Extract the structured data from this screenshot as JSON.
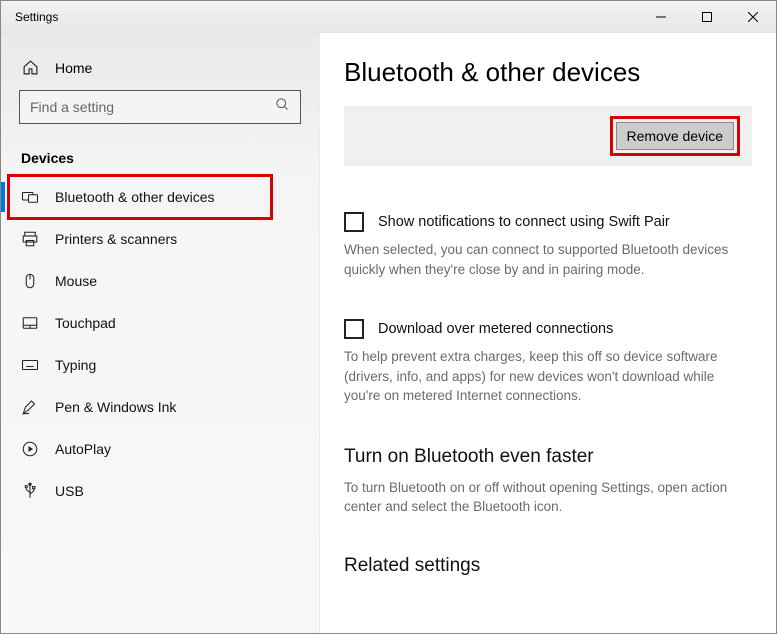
{
  "window_title": "Settings",
  "sidebar": {
    "home_label": "Home",
    "search_placeholder": "Find a setting",
    "section_header": "Devices",
    "items": [
      {
        "label": "Bluetooth & other devices",
        "selected": true,
        "highlighted": true
      },
      {
        "label": "Printers & scanners"
      },
      {
        "label": "Mouse"
      },
      {
        "label": "Touchpad"
      },
      {
        "label": "Typing"
      },
      {
        "label": "Pen & Windows Ink"
      },
      {
        "label": "AutoPlay"
      },
      {
        "label": "USB"
      }
    ]
  },
  "main": {
    "title": "Bluetooth & other devices",
    "remove_label": "Remove device",
    "opt1_label": "Show notifications to connect using Swift Pair",
    "opt1_desc": "When selected, you can connect to supported Bluetooth devices quickly when they're close by and in pairing mode.",
    "opt2_label": "Download over metered connections",
    "opt2_desc": "To help prevent extra charges, keep this off so device software (drivers, info, and apps) for new devices won't download while you're on metered Internet connections.",
    "faster_heading": "Turn on Bluetooth even faster",
    "faster_desc": "To turn Bluetooth on or off without opening Settings, open action center and select the Bluetooth icon.",
    "related_heading": "Related settings"
  }
}
